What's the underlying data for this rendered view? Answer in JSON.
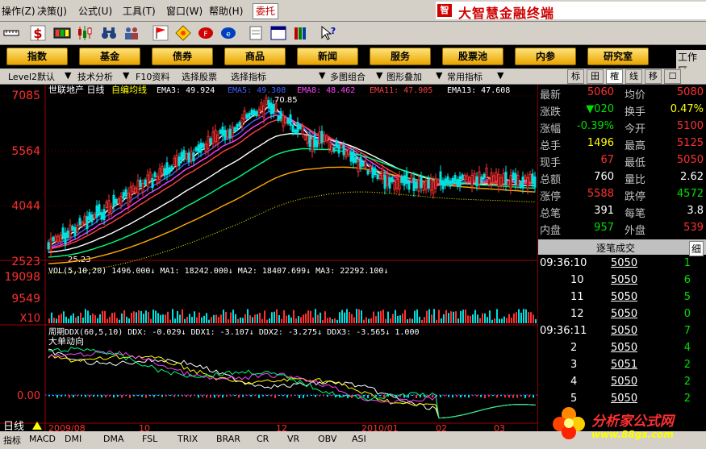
{
  "menu": {
    "items": [
      "操作(Z)",
      "决策(J)",
      "公式(U)",
      "工具(T)",
      "窗口(W)",
      "帮助(H)"
    ],
    "trade_label": "委托",
    "brand": "大智慧金融终端"
  },
  "nav": {
    "items": [
      "指数",
      "基金",
      "债券",
      "商品",
      "新闻",
      "服务",
      "股票池",
      "内参",
      "研究室"
    ],
    "workspace": "工作区"
  },
  "subtool": {
    "items": [
      "Level2默认",
      "技术分析",
      "F10资料",
      "选择股票",
      "选择指标",
      "多图组合",
      "图形叠加",
      "常用指标"
    ],
    "tabs": [
      "标",
      "田",
      "榷",
      "线",
      "移",
      "☐"
    ]
  },
  "chart": {
    "stock_name": "世联地产 日线",
    "indicator_name": "自编均线",
    "ema": [
      {
        "label": "EMA3: 49.924",
        "color": "#ffffff"
      },
      {
        "label": "EMA5: 49.308",
        "color": "#4060ff"
      },
      {
        "label": "EMA8: 48.462",
        "color": "#ff40ff"
      },
      {
        "label": "EMA11: 47.905",
        "color": "#ff4040"
      },
      {
        "label": "EMA13: 47.608",
        "color": "#ffffff"
      }
    ],
    "price_axis": [
      "7085",
      "5564",
      "4044",
      "2523"
    ],
    "high_label": "70.85",
    "low_label": "25.23",
    "vol_header": "VOL(5,10,20) 1496.000↓ MA1: 18242.000↓ MA2: 18407.699↓ MA3: 22292.100↓",
    "vol_axis": [
      "19098",
      "9549",
      "X10"
    ],
    "ddx_header": "周期DDX(60,5,10) DDX: -0.029↓ DDX1: -3.107↓ DDX2: -3.275↓ DDX3: -3.565↓ 1.000",
    "ddx_sub": "大单动向",
    "ddx_axis": [
      "0.00"
    ],
    "date_labels": [
      "2009/08",
      "10",
      "12",
      "2010/01",
      "02",
      "03"
    ],
    "period_label": "日线"
  },
  "quote": {
    "rows": [
      {
        "l1": "最新",
        "v1": "5060",
        "c1": "red",
        "l2": "均价",
        "v2": "5080",
        "c2": "red"
      },
      {
        "l1": "涨跌",
        "v1": "▼020",
        "c1": "green",
        "l2": "换手",
        "v2": "0.47%",
        "c2": "yellow"
      },
      {
        "l1": "涨幅",
        "v1": "-0.39%",
        "c1": "green",
        "l2": "今开",
        "v2": "5100",
        "c2": "red"
      },
      {
        "l1": "总手",
        "v1": "1496",
        "c1": "yellow",
        "l2": "最高",
        "v2": "5125",
        "c2": "red"
      },
      {
        "l1": "现手",
        "v1": "67",
        "c1": "red",
        "l2": "最低",
        "v2": "5050",
        "c2": "red"
      },
      {
        "l1": "总额",
        "v1": "760",
        "c1": "white",
        "l2": "量比",
        "v2": "2.62",
        "c2": "white"
      },
      {
        "l1": "涨停",
        "v1": "5588",
        "c1": "red",
        "l2": "跌停",
        "v2": "4572",
        "c2": "green"
      },
      {
        "l1": "总笔",
        "v1": "391",
        "c1": "white",
        "l2": "每笔",
        "v2": "3.8",
        "c2": "white"
      },
      {
        "l1": "内盘",
        "v1": "957",
        "c1": "green",
        "l2": "外盘",
        "v2": "539",
        "c2": "red"
      }
    ],
    "ticks_title": "逐笔成交",
    "ticks_btn": "细",
    "ticks": [
      {
        "t": "09:36:10",
        "p": "5050",
        "v": "1"
      },
      {
        "t": "10",
        "p": "5050",
        "v": "6"
      },
      {
        "t": "11",
        "p": "5050",
        "v": "5"
      },
      {
        "t": "12",
        "p": "5050",
        "v": "0"
      },
      {
        "t": "09:36:11",
        "p": "5050",
        "v": "7"
      },
      {
        "t": "2",
        "p": "5050",
        "v": "4"
      },
      {
        "t": "3",
        "p": "5051",
        "v": "2"
      },
      {
        "t": "4",
        "p": "5050",
        "v": "2"
      },
      {
        "t": "5",
        "p": "5050",
        "v": "2"
      }
    ]
  },
  "bottom": {
    "tabs": [
      "指标",
      "MACD",
      "DMI",
      "DMA",
      "FSL",
      "TRIX",
      "BRAR",
      "CR",
      "VR",
      "OBV",
      "ASI"
    ]
  },
  "watermark": {
    "line1": "分析家公式网",
    "line2": "www.88gs.com"
  }
}
